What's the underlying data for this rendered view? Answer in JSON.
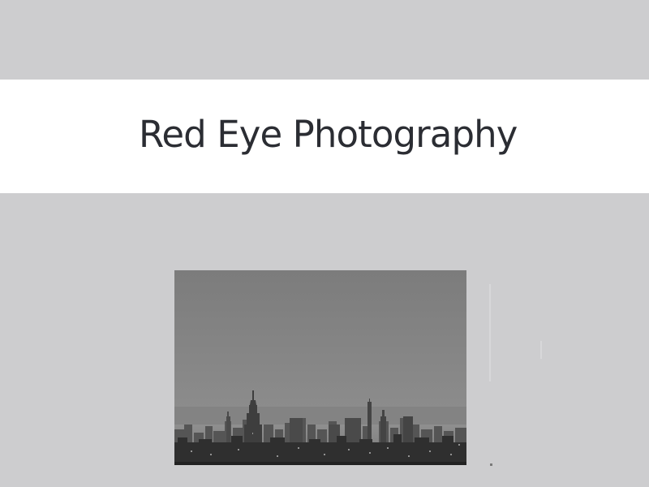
{
  "header": {
    "site_title": "Red Eye Photography"
  },
  "photo": {
    "icon": "city-skyline-image",
    "style": "black-and-white"
  },
  "colors": {
    "page_background": "#cdcdcf",
    "banner_background": "#ffffff",
    "title_text": "#2b2d33"
  }
}
